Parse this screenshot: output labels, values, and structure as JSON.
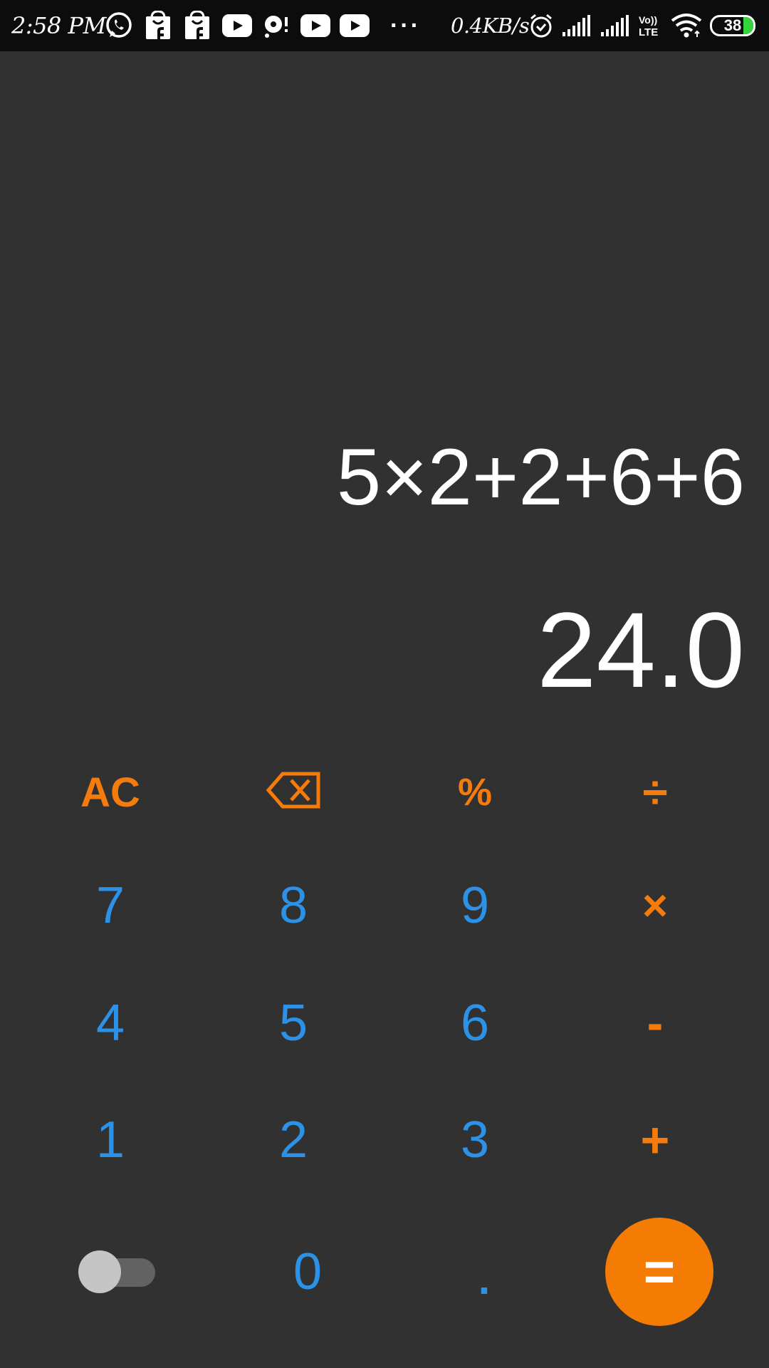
{
  "status_bar": {
    "time": "2:58 PM",
    "net_speed": "0.4KB/s",
    "more": "···",
    "battery_level": "38",
    "battery_color": "#35d43a",
    "icons": [
      "whatsapp-icon",
      "shopping-bag-icon",
      "shopping-bag-icon",
      "youtube-icon",
      "notification-icon",
      "youtube-icon",
      "youtube-icon",
      "alarm-icon",
      "signal-icon",
      "signal-icon",
      "volte-icon",
      "wifi-icon",
      "battery-icon"
    ]
  },
  "display": {
    "expression": "5×2+2+6+6",
    "result": "24.0"
  },
  "keypad": {
    "ac": "AC",
    "backspace_icon": "backspace-icon",
    "percent": "%",
    "divide": "÷",
    "seven": "7",
    "eight": "8",
    "nine": "9",
    "multiply": "×",
    "four": "4",
    "five": "5",
    "six": "6",
    "subtract": "-",
    "one": "1",
    "two": "2",
    "three": "3",
    "add": "+",
    "zero": "0",
    "decimal": ".",
    "equals": "="
  },
  "theme_toggle": {
    "state": "off"
  },
  "colors": {
    "background": "#313131",
    "number_keys": "#2b92e8",
    "operator_keys": "#f57c0c",
    "equals_button": "#f57c04",
    "text": "#ffffff"
  }
}
